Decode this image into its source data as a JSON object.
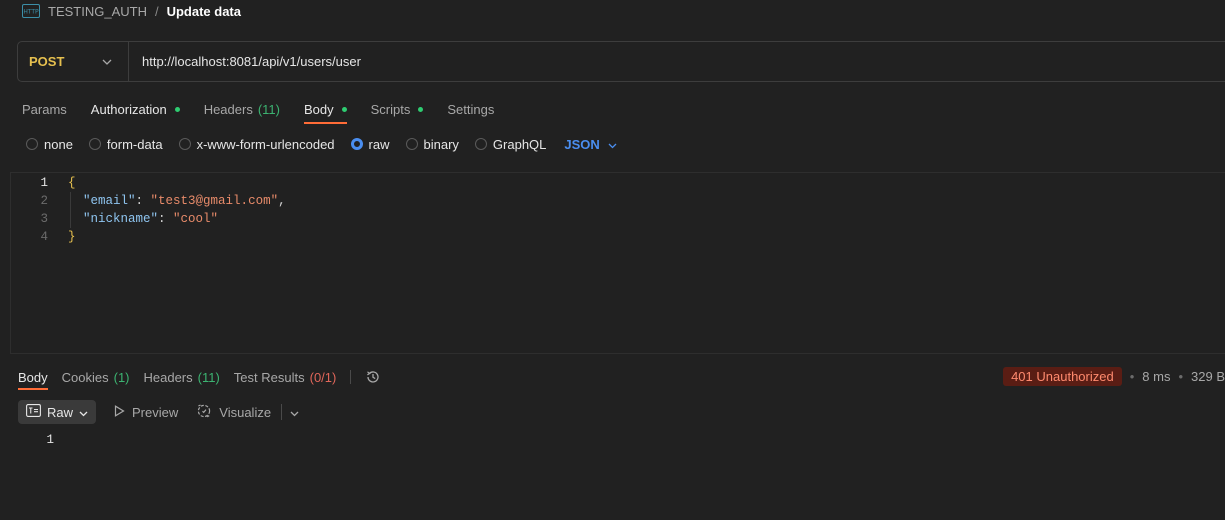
{
  "breadcrumb": {
    "icon": "http-icon",
    "collection": "TESTING_AUTH",
    "separator": "/",
    "request": "Update data"
  },
  "urlbar": {
    "method": "POST",
    "url": "http://localhost:8081/api/v1/users/user"
  },
  "request_tabs": [
    {
      "label": "Params",
      "count": "",
      "dot": false,
      "active": false
    },
    {
      "label": "Authorization",
      "count": "",
      "dot": true,
      "active": false
    },
    {
      "label": "Headers",
      "count": "(11)",
      "dot": false,
      "active": false
    },
    {
      "label": "Body",
      "count": "",
      "dot": true,
      "active": true
    },
    {
      "label": "Scripts",
      "count": "",
      "dot": true,
      "active": false
    },
    {
      "label": "Settings",
      "count": "",
      "dot": false,
      "active": false
    }
  ],
  "body_types": {
    "options": [
      "none",
      "form-data",
      "x-www-form-urlencoded",
      "raw",
      "binary",
      "GraphQL"
    ],
    "selected": "raw",
    "format": "JSON"
  },
  "editor": {
    "line_numbers": [
      "1",
      "2",
      "3",
      "4"
    ],
    "open_brace": "{",
    "close_brace": "}",
    "email_key": "\"email\"",
    "email_value": "\"test3@gmail.com\"",
    "nickname_key": "\"nickname\"",
    "nickname_value": "\"cool\"",
    "colon": ": ",
    "comma": ","
  },
  "response_tabs": {
    "body": "Body",
    "cookies": "Cookies",
    "cookies_count": "(1)",
    "headers": "Headers",
    "headers_count": "(11)",
    "tests": "Test Results",
    "tests_count": "(0/1)"
  },
  "response_meta": {
    "status": "401 Unauthorized",
    "time": "8 ms",
    "size": "329 B",
    "dot": "•"
  },
  "response_toolbar": {
    "raw": "Raw",
    "preview": "Preview",
    "visualize": "Visualize"
  },
  "response_body": {
    "line_number": "1"
  },
  "colors": {
    "accent_orange": "#ff6c37",
    "method_yellow": "#e6c04f",
    "link_blue": "#4a8ef0",
    "status_green": "#2ecc71",
    "error_bg": "#5a1d14",
    "error_text": "#ff8a6e"
  }
}
